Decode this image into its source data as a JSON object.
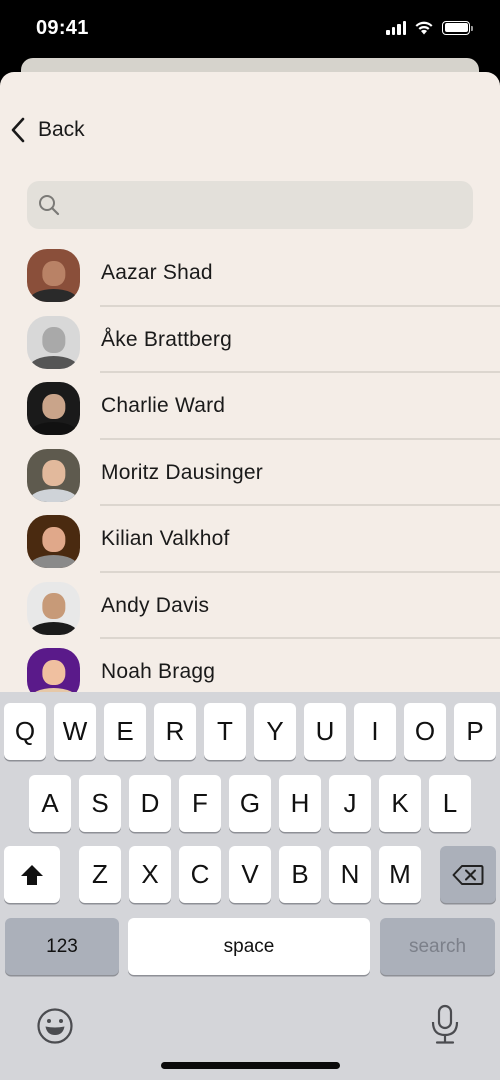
{
  "status_bar": {
    "time": "09:41",
    "icons": [
      "cellular-signal-icon",
      "wifi-icon",
      "battery-icon"
    ]
  },
  "nav": {
    "back_label": "Back",
    "back_icon": "chevron-left-icon"
  },
  "search": {
    "value": "",
    "placeholder": "",
    "icon": "search-icon"
  },
  "contacts": [
    {
      "name": "Aazar Shad",
      "avatar_bg": "#8a4f3a",
      "skin": "#b98266",
      "shirt": "#2a2a2a"
    },
    {
      "name": "Åke Brattberg",
      "avatar_bg": "#d8d8d8",
      "skin": "#a9a9a9",
      "shirt": "#555555"
    },
    {
      "name": "Charlie Ward",
      "avatar_bg": "#1a1a1a",
      "skin": "#c9a48a",
      "shirt": "#111111"
    },
    {
      "name": "Moritz Dausinger",
      "avatar_bg": "#5e5a4e",
      "skin": "#e2b99c",
      "shirt": "#cfd3d8"
    },
    {
      "name": "Kilian Valkhof",
      "avatar_bg": "#4a2a10",
      "skin": "#e0a88a",
      "shirt": "#8a8a8a"
    },
    {
      "name": "Andy Davis",
      "avatar_bg": "#e8e8e8",
      "skin": "#c79a78",
      "shirt": "#1b1b1b"
    },
    {
      "name": "Noah Bragg",
      "avatar_bg": "#5a1a8a",
      "skin": "#f0c0a0",
      "shirt": "#e6c8a8"
    }
  ],
  "keyboard": {
    "row1": [
      "Q",
      "W",
      "E",
      "R",
      "T",
      "Y",
      "U",
      "I",
      "O",
      "P"
    ],
    "row2": [
      "A",
      "S",
      "D",
      "F",
      "G",
      "H",
      "J",
      "K",
      "L"
    ],
    "row3": [
      "Z",
      "X",
      "C",
      "V",
      "B",
      "N",
      "M"
    ],
    "numbers_label": "123",
    "space_label": "space",
    "return_label": "search",
    "shift_icon": "shift-icon",
    "backspace_icon": "backspace-icon",
    "emoji_icon": "emoji-icon",
    "mic_icon": "microphone-icon"
  },
  "colors": {
    "sheet_bg": "#f4ede7",
    "search_bg": "#e3e0da",
    "keyboard_bg": "#d4d5d9"
  }
}
